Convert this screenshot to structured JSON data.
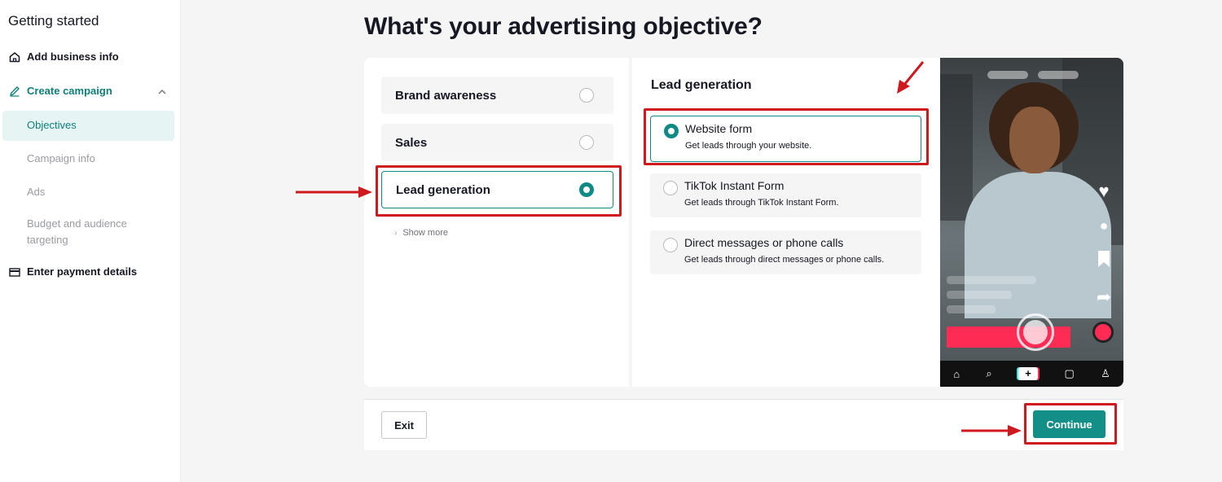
{
  "sidebar": {
    "title": "Getting started",
    "add_business": "Add business info",
    "create_campaign": "Create campaign",
    "steps": [
      "Objectives",
      "Campaign info",
      "Ads",
      "Budget and audience targeting"
    ],
    "payment": "Enter payment details"
  },
  "main": {
    "heading": "What's your advertising objective?",
    "objectives": [
      {
        "label": "Brand awareness",
        "selected": false
      },
      {
        "label": "Sales",
        "selected": false
      },
      {
        "label": "Lead generation",
        "selected": true
      }
    ],
    "show_more": "Show more",
    "detail_title": "Lead generation",
    "options": [
      {
        "title": "Website form",
        "desc": "Get leads through your website.",
        "selected": true
      },
      {
        "title": "TikTok Instant Form",
        "desc": "Get leads through TikTok Instant Form.",
        "selected": false
      },
      {
        "title": "Direct messages or phone calls",
        "desc": "Get leads through direct messages or phone calls.",
        "selected": false
      }
    ]
  },
  "footer": {
    "exit_label": "Exit",
    "continue_label": "Continue"
  },
  "colors": {
    "accent": "#138f88",
    "annotation": "#d0181f",
    "tiktok_red": "#fe2c55"
  },
  "icons": {
    "add_business": "home-icon",
    "create_campaign": "pencil-icon",
    "payment": "card-icon"
  }
}
